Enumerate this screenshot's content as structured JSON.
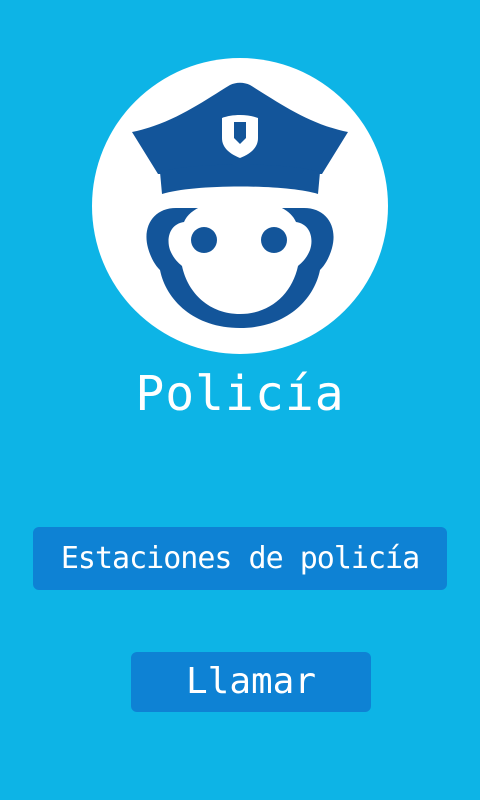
{
  "app": {
    "title": "Policía"
  },
  "buttons": {
    "stations_label": "Estaciones de policía",
    "call_label": "Llamar"
  },
  "icons": {
    "logo": "police-officer-icon"
  },
  "colors": {
    "background": "#0db4e6",
    "button": "#0e82d4",
    "icon": "#13559a",
    "text": "#ffffff",
    "circle": "#ffffff"
  }
}
